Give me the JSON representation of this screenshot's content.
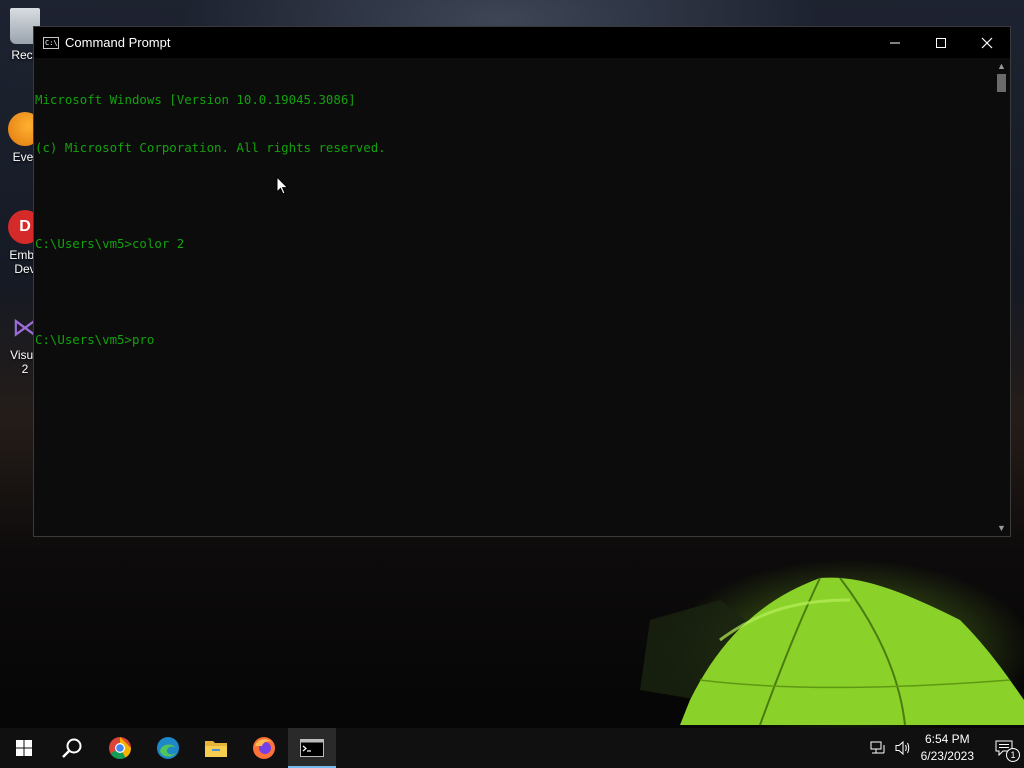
{
  "desktop": {
    "icons": [
      {
        "label": "Recy",
        "icon": "recycle-bin-icon"
      },
      {
        "label": "Ever",
        "icon": "everything-icon"
      },
      {
        "label": "Emba",
        "label2": "Dev",
        "icon": "embarcadero-dev-icon"
      },
      {
        "label": "Visua",
        "label2": "2",
        "icon": "visual-studio-icon"
      }
    ]
  },
  "window": {
    "title": "Command Prompt",
    "icon": "cmd-icon",
    "controls": {
      "minimize": "minimize-icon",
      "maximize": "maximize-icon",
      "close": "close-icon"
    }
  },
  "console": {
    "text_color": "#13a10e",
    "lines": [
      "Microsoft Windows [Version 10.0.19045.3086]",
      "(c) Microsoft Corporation. All rights reserved.",
      "",
      "C:\\Users\\vm5>color 2",
      "",
      "C:\\Users\\vm5>pro"
    ]
  },
  "taskbar": {
    "items": [
      {
        "name": "start-button",
        "icon": "windows-icon"
      },
      {
        "name": "search-button",
        "icon": "search-icon"
      },
      {
        "name": "chrome",
        "icon": "chrome-icon"
      },
      {
        "name": "edge",
        "icon": "edge-icon"
      },
      {
        "name": "file-explorer",
        "icon": "folder-icon"
      },
      {
        "name": "firefox",
        "icon": "firefox-icon"
      },
      {
        "name": "command-prompt",
        "icon": "cmd-icon",
        "active": true
      }
    ],
    "tray": {
      "network_icon": "network-icon",
      "volume_icon": "volume-icon",
      "time": "6:54 PM",
      "date": "6/23/2023",
      "notification_count": "1"
    },
    "accent_color": "#76b9ed"
  }
}
